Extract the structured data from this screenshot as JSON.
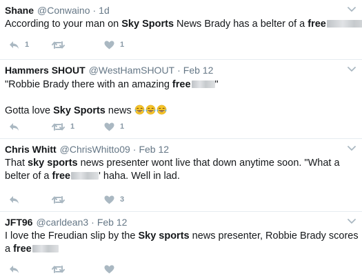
{
  "tweets": [
    {
      "name": "Shane",
      "handle": "@Conwaino",
      "time": "1d",
      "lines": [
        [
          {
            "t": "According to your man on "
          },
          {
            "t": "Sky Sports",
            "b": true
          },
          {
            "t": " News Brady has a belter of a "
          },
          {
            "t": "free",
            "b": true
          }
        ]
      ],
      "reply_count": "1",
      "retweet_count": "",
      "like_count": "1"
    },
    {
      "name": "Hammers SHOUT",
      "handle": "@WestHamSHOUT",
      "time": "Feb 12",
      "lines": [
        [
          {
            "t": "\"Robbie Brady there with an amazing "
          },
          {
            "t": "free",
            "b": true
          },
          {
            "t": "\""
          }
        ],
        [],
        [
          {
            "t": "Gotta love "
          },
          {
            "t": "Sky Sports",
            "b": true
          },
          {
            "t": " news "
          }
        ]
      ],
      "emoji": "face-with-tears-of-joy",
      "reply_count": "",
      "retweet_count": "1",
      "like_count": "1"
    },
    {
      "name": "Chris Whitt",
      "handle": "@ChrisWhitto09",
      "time": "Feb 12",
      "lines": [
        [
          {
            "t": "That "
          },
          {
            "t": "sky sports",
            "b": true
          },
          {
            "t": " news presenter wont live that down anytime soon. \"What a"
          }
        ],
        [
          {
            "t": "belter of a "
          },
          {
            "t": "free",
            "b": true
          },
          {
            "t": "' haha. Well in lad."
          }
        ]
      ],
      "reply_count": "",
      "retweet_count": "",
      "like_count": "3"
    },
    {
      "name": "JFT96",
      "handle": "@carldean3",
      "time": "Feb 12",
      "lines": [
        [
          {
            "t": "I love the Freudian slip by the "
          },
          {
            "t": "Sky sports",
            "b": true
          },
          {
            "t": " news presenter, Robbie Brady scores"
          }
        ],
        [
          {
            "t": "a "
          },
          {
            "t": "free",
            "b": true
          }
        ]
      ],
      "reply_count": "",
      "retweet_count": "",
      "like_count": ""
    }
  ],
  "colors": {
    "icon": "#aab8c2",
    "count": "#8899a6",
    "divider": "#e6ecf0",
    "handle": "#657786"
  },
  "icons": [
    "reply-icon",
    "retweet-icon",
    "like-icon",
    "caret-down-icon",
    "tears-of-joy-emoji"
  ]
}
